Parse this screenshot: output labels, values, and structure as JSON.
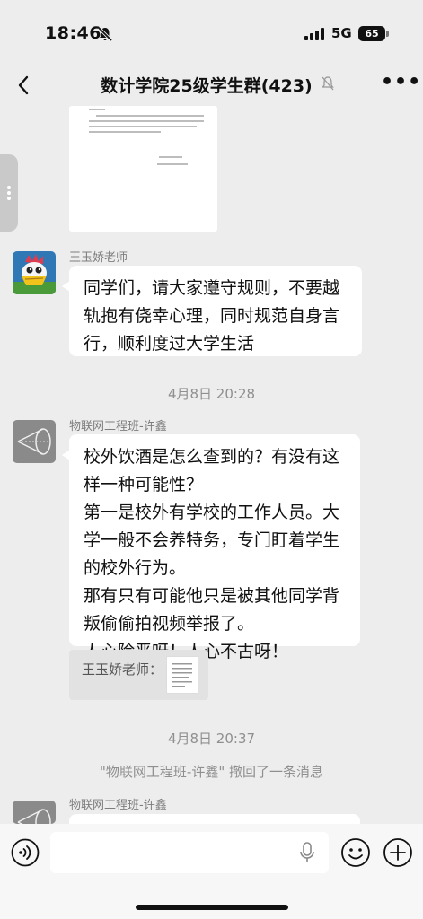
{
  "status_bar": {
    "time": "18:46",
    "network": "5G",
    "battery": "65"
  },
  "header": {
    "title": "数计学院25级学生群(423)"
  },
  "messages": [
    {
      "sender": "王玉娇老师",
      "text": "同学们，请大家遵守规则，不要越\n轨抱有侥幸心理，同时规范自身言\n行，顺利度过大学生活"
    },
    {
      "timestamp": "4月8日 20:28"
    },
    {
      "sender": "物联网工程班-许鑫",
      "text": "校外饮酒是怎么查到的？有没有这\n样一种可能性？\n第一是校外有学校的工作人员。大\n学一般不会养特务，专门盯着学生\n的校外行为。\n那有只有可能他只是被其他同学背\n叛偷偷拍视频举报了。\n人心险恶呀！人心不古呀！",
      "quote": "王玉娇老师："
    },
    {
      "timestamp": "4月8日 20:37"
    },
    {
      "recall_notice": "\"物联网工程班-许鑫\" 撤回了一条消息"
    },
    {
      "sender": "物联网工程班-许鑫"
    }
  ],
  "icons": {
    "back": "chevron-left-icon",
    "mute": "bell-slash-icon",
    "more": "more-icon",
    "voice": "voice-icon",
    "mic": "mic-icon",
    "emoji": "emoji-icon",
    "plus": "plus-icon"
  },
  "colors": {
    "background": "#ededed",
    "bubble": "#ffffff",
    "meta_text": "#8f8f8f"
  }
}
